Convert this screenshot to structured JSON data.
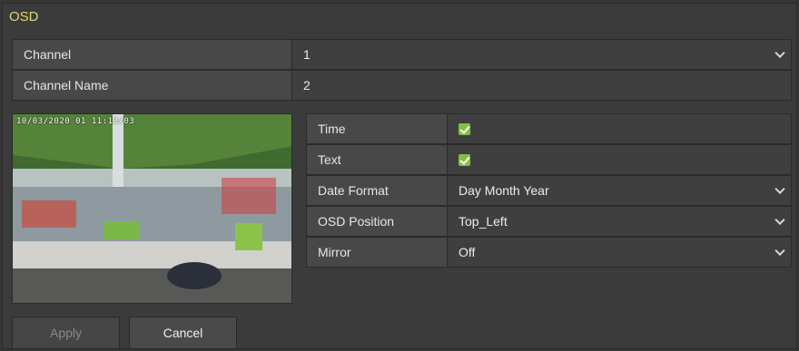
{
  "title": "OSD",
  "channel": {
    "label": "Channel",
    "value": "1"
  },
  "channel_name": {
    "label": "Channel Name",
    "value": "2"
  },
  "preview": {
    "osd_stamp": "10/03/2020 01 11:13/03"
  },
  "settings": {
    "time": {
      "label": "Time",
      "checked": true
    },
    "text": {
      "label": "Text",
      "checked": true
    },
    "date_format": {
      "label": "Date Format",
      "value": "Day Month Year"
    },
    "osd_position": {
      "label": "OSD Position",
      "value": "Top_Left"
    },
    "mirror": {
      "label": "Mirror",
      "value": "Off"
    }
  },
  "buttons": {
    "apply": "Apply",
    "cancel": "Cancel"
  },
  "colors": {
    "accent": "#e7d36a",
    "check": "#7fc241",
    "background": "#3b3b3b"
  }
}
